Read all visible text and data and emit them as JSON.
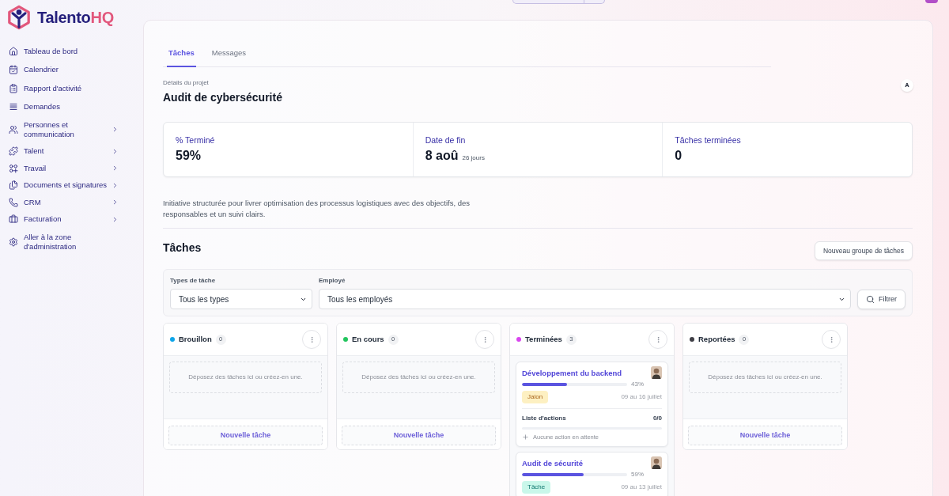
{
  "brand": {
    "name": "Talento",
    "accent": "HQ"
  },
  "sidebar": {
    "items": [
      {
        "label": "Tableau de bord",
        "has_submenu": false
      },
      {
        "label": "Calendrier",
        "has_submenu": false
      },
      {
        "label": "Rapport d'activité",
        "has_submenu": false
      },
      {
        "label": "Demandes",
        "has_submenu": false
      },
      {
        "label": "Personnes et communication",
        "has_submenu": true
      },
      {
        "label": "Talent",
        "has_submenu": true
      },
      {
        "label": "Travail",
        "has_submenu": true
      },
      {
        "label": "Documents et signatures",
        "has_submenu": true
      },
      {
        "label": "CRM",
        "has_submenu": true
      },
      {
        "label": "Facturation",
        "has_submenu": true
      },
      {
        "label": "Aller à la zone d'administration",
        "has_submenu": false
      }
    ]
  },
  "tabs": [
    {
      "label": "Tâches",
      "selected": true
    },
    {
      "label": "Messages",
      "selected": false
    }
  ],
  "project": {
    "eyebrow": "Détails du projet",
    "title": "Audit de cybersécurité",
    "owner_initial": "A"
  },
  "stats": [
    {
      "label": "% Terminé",
      "value": "59%"
    },
    {
      "label": "Date de fin",
      "value": "8 aoû",
      "note": "26 jours"
    },
    {
      "label": "Tâches terminées",
      "value": "0"
    }
  ],
  "description": "Initiative structurée pour livrer optimisation des processus logistiques avec des objectifs, des responsables et un suivi clairs.",
  "tasks_section": {
    "title": "Tâches",
    "new_group_button": "Nouveau groupe de tâches"
  },
  "filters": {
    "fields": [
      {
        "label": "Types de tâche",
        "value": "Tous les types"
      },
      {
        "label": "Employé",
        "value": "Tous les employés"
      }
    ],
    "button": "Filtrer"
  },
  "columns": [
    {
      "name": "Brouillon",
      "color": "#0ea5e9",
      "count": "0",
      "empty_text": "Déposez des tâches ici ou créez-en une.",
      "add_button": "Nouvelle tâche"
    },
    {
      "name": "En cours",
      "color": "#22c55e",
      "count": "0",
      "empty_text": "Déposez des tâches ici ou créez-en une.",
      "add_button": "Nouvelle tâche"
    },
    {
      "name": "Terminées",
      "color": "#d946ef",
      "count": "3",
      "cards": [
        {
          "title": "Développement du backend",
          "level": 0.43,
          "percent": "43%",
          "tag": {
            "label": "Jalon",
            "kind": "milestone"
          },
          "dates": "09 au 16 juillet",
          "checklist": {
            "label": "Liste d'actions",
            "count": "0/0",
            "empty_text": "Aucune action en attente"
          }
        },
        {
          "title": "Audit de sécurité",
          "level": 0.59,
          "percent": "59%",
          "tag": {
            "label": "Tâche",
            "kind": "task"
          },
          "dates": "09 au 13 juillet"
        }
      ]
    },
    {
      "name": "Reportées",
      "color": "#3f3f46",
      "count": "0",
      "empty_text": "Déposez des tâches ici ou créez-en une.",
      "add_button": "Nouvelle tâche"
    }
  ]
}
